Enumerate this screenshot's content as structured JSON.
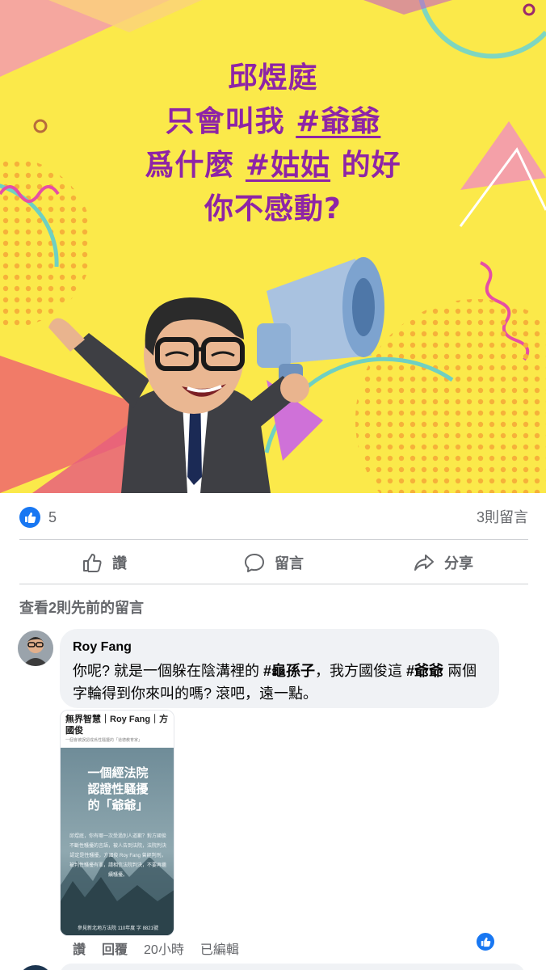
{
  "post": {
    "headline": {
      "line1": "邱煜庭",
      "line2_prefix": "只會叫我 ",
      "line2_tag": "#爺爺",
      "line3_prefix": "爲什麼 ",
      "line3_tag": "#姑姑",
      "line3_suffix": " 的好",
      "line4": "你不感動?"
    },
    "like_count": "5",
    "comment_count": "3則留言",
    "actions": {
      "like": "讚",
      "comment": "留言",
      "share": "分享"
    }
  },
  "comments": {
    "view_previous": "查看2則先前的留言",
    "items": [
      {
        "author": "Roy Fang",
        "text_part1": "你呢? 就是一個躲在陰溝裡的 ",
        "text_bold1": "#龜孫子",
        "text_part2": "，我方國俊這 ",
        "text_bold2": "#爺爺",
        "text_part3": " 兩個字輪得到你來叫的嗎? 滾吧，遠一點。",
        "attachment": {
          "header_title": "無界智慧｜Roy Fang｜方國俊",
          "header_subtitle": "一個會被誤認成爲性騷擾的「道德教育家」",
          "big_title_line1": "一個經法院",
          "big_title_line2": "認證性騷擾",
          "big_title_line3": "的「爺爺」",
          "body_text": "邱煜庭，你有哪一次受過別人道歉？對方國俊不斷性騷擾的言語，被人告到法院，法院判決認定是性騷擾，方國俊 Roy Fang 曾經判刑，被判性騷擾有罪，請相信法院判決，不要再繼續騷擾。",
          "footer": "參見新北地方法院 110年度 字 8821號"
        },
        "meta": {
          "like": "讚",
          "reply": "回覆",
          "time": "20小時",
          "edited": "已編輯"
        }
      }
    ]
  },
  "colors": {
    "hero_background": "#fbe94a",
    "headline": "#8e24a6",
    "facebook_blue": "#1877f2",
    "secondary_text": "#65676b",
    "bubble_bg": "#f0f2f5"
  },
  "icons": {
    "like_badge": "thumbs-up-icon",
    "like_action": "thumbs-up-outline-icon",
    "comment_action": "speech-bubble-icon",
    "share_action": "share-arrow-icon"
  }
}
